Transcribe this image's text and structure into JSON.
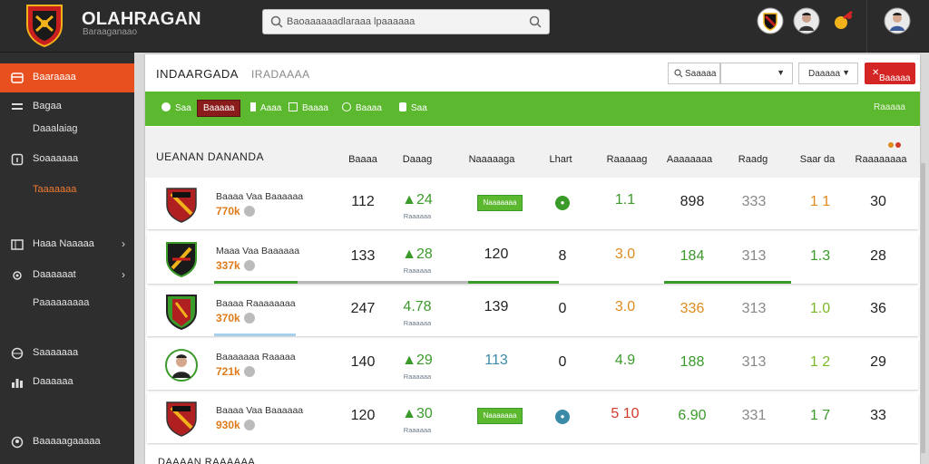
{
  "topbar": {
    "brand_title": "OLAHRAGAN",
    "brand_sub": "Baraaganaao",
    "search_placeholder": "Baoaaaaaadlaraaa lpaaaaaa"
  },
  "sidebar": {
    "items": [
      {
        "label": "Baaraaaa",
        "icon": "grid-icon"
      },
      {
        "label": "Bagaa",
        "icon": "list-icon"
      },
      {
        "label": "Soaaaaaa",
        "icon": "info-icon"
      },
      {
        "label": "Haaa Naaaaa",
        "icon": "table-icon"
      },
      {
        "label": "Daaaaaat",
        "icon": "settings-icon"
      },
      {
        "label": "Saaaaaaa",
        "icon": "globe-icon"
      },
      {
        "label": "Daaaaaa",
        "icon": "chart-icon"
      },
      {
        "label": "Baaaaagaaaaa",
        "icon": "user-icon"
      }
    ],
    "subs": [
      "Daaalaiag",
      "Taaaaaaa",
      "Paaaaaaaaa"
    ]
  },
  "panel": {
    "title": "INDAARGADA",
    "subtitle": "IRADAAAA",
    "filter_label": "Saaaaa",
    "sort_label": "Daaaaa",
    "action_label": "Baaaaa"
  },
  "tabs": [
    {
      "label": "Saa",
      "active": false
    },
    {
      "label": "Baaaaa",
      "active": true
    },
    {
      "label": "Aaaa",
      "active": false
    },
    {
      "label": "Baaaa",
      "active": false
    },
    {
      "label": "Baaaa",
      "active": false
    },
    {
      "label": "Saa",
      "active": false
    }
  ],
  "tabs_right": "Raaaaa",
  "table": {
    "title": "UEANAN DANANDA",
    "headers": [
      "Baaaa",
      "Daaag",
      "Naaaaaga",
      "Lhart",
      "Raaaaag",
      "Aaaaaaaa",
      "Raadg",
      "Saar da",
      "Raaaaaaaa"
    ],
    "rows": [
      {
        "name": "Baaaa Vaa Baaaaaa",
        "value": "770k",
        "c1": "112",
        "c2": "24",
        "c2s": "Raaaaaa",
        "c3": "",
        "c4": "",
        "c5": "1.1",
        "c6": "898",
        "c7": "333",
        "c8": "1 1",
        "c9": "30",
        "badge": "Naaaaaaa",
        "avatar": false
      },
      {
        "name": "Maaa Vaa Baaaaaa",
        "value": "337k",
        "c1": "133",
        "c2": "28",
        "c2s": "Raaaaaa",
        "c3": "120",
        "c4": "8",
        "c5": "3.0",
        "c6": "184",
        "c7": "313",
        "c8": "1.3",
        "c9": "28",
        "badge": "",
        "avatar": false
      },
      {
        "name": "Baaaa Raaaaaaaa",
        "value": "370k",
        "c1": "247",
        "c2": "4.78",
        "c2s": "Raaaaaa",
        "c3": "139",
        "c4": "0",
        "c5": "3.0",
        "c6": "336",
        "c7": "313",
        "c8": "1.0",
        "c9": "36",
        "badge": "",
        "avatar": false
      },
      {
        "name": "Baaaaaaa Raaaaa",
        "value": "721k",
        "c1": "140",
        "c2": "29",
        "c2s": "Raaaaaa",
        "c3": "113",
        "c4": "0",
        "c5": "4.9",
        "c6": "188",
        "c7": "313",
        "c8": "1 2",
        "c9": "29",
        "badge": "",
        "avatar": true
      },
      {
        "name": "Baaaa Vaa Baaaaaa",
        "value": "930k",
        "c1": "120",
        "c2": "30",
        "c2s": "Raaaaaa",
        "c3": "",
        "c4": "",
        "c5": "5 10",
        "c6": "6.90",
        "c7": "331",
        "c8": "1 7",
        "c9": "33",
        "badge": "Naaaaaaa",
        "avatar": false
      }
    ]
  },
  "bottom_title": "DAAAAN RAAAAAA",
  "colors": {
    "accent": "#e8501f",
    "green": "#5cb82f",
    "red": "#d42525",
    "dark": "#2b2b2b"
  }
}
